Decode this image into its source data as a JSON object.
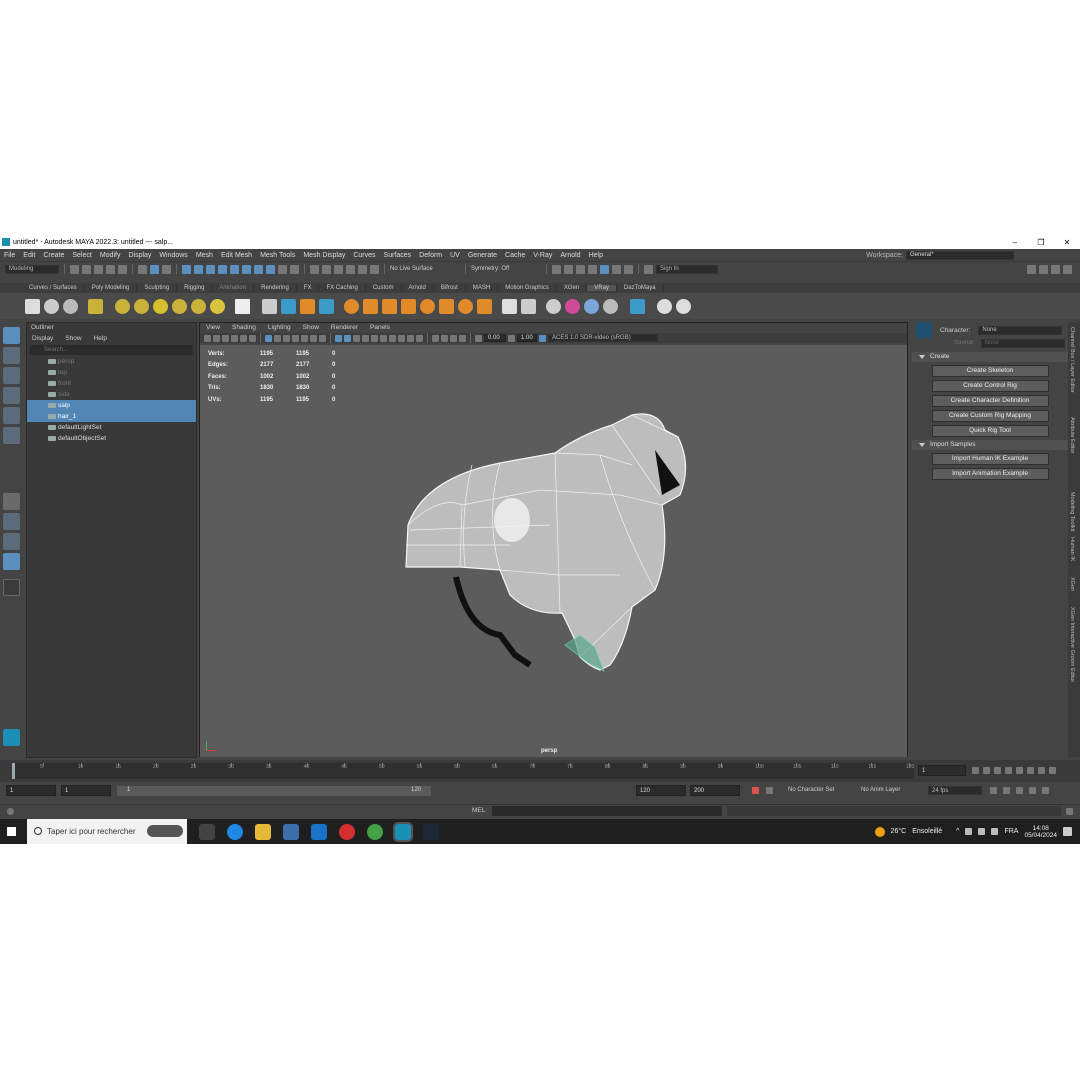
{
  "window": {
    "title": "untitled* - Autodesk MAYA 2022.3: untitled   ---   salp...",
    "controls": [
      "–",
      "❐",
      "✕"
    ]
  },
  "menubar": {
    "items": [
      "File",
      "Edit",
      "Create",
      "Select",
      "Modify",
      "Display",
      "Windows",
      "Mesh",
      "Edit Mesh",
      "Mesh Tools",
      "Mesh Display",
      "Curves",
      "Surfaces",
      "Deform",
      "UV",
      "Generate",
      "Cache",
      "V-Ray",
      "Arnold",
      "Help"
    ],
    "workspace_label": "Workspace:",
    "workspace_value": "General*"
  },
  "statusline": {
    "mode": "Modeling",
    "live_surface": "No Live Surface",
    "symmetry": "Symmetry: Off",
    "sign_in": "Sign In"
  },
  "shelf": {
    "tabs": [
      "Curves / Surfaces",
      "Poly Modeling",
      "Sculpting",
      "Rigging",
      "Animation",
      "Rendering",
      "FX",
      "FX Caching",
      "Custom",
      "Arnold",
      "Bifrost",
      "MASH",
      "Motion Graphics",
      "XGen",
      "VRay",
      "DazToMaya"
    ],
    "active_tab": "VRay"
  },
  "outliner": {
    "title": "Outliner",
    "menu": [
      "Display",
      "Show",
      "Help"
    ],
    "search_placeholder": "Search...",
    "items": [
      {
        "label": "persp",
        "state": "dim"
      },
      {
        "label": "top",
        "state": "dim"
      },
      {
        "label": "front",
        "state": "dim"
      },
      {
        "label": "side",
        "state": "dim"
      },
      {
        "label": "salp",
        "state": "selected"
      },
      {
        "label": "hair_1",
        "state": "selected"
      },
      {
        "label": "defaultLightSet",
        "state": "normal"
      },
      {
        "label": "defaultObjectSet",
        "state": "normal"
      }
    ]
  },
  "viewport": {
    "menu": [
      "View",
      "Shading",
      "Lighting",
      "Show",
      "Renderer",
      "Panels"
    ],
    "exposure": "0.00",
    "gamma": "1.00",
    "color_space": "ACES 1.0 SDR-video (sRGB)",
    "camera": "persp",
    "hud": [
      {
        "label": "Verts:",
        "a": "1195",
        "b": "1195",
        "c": "0"
      },
      {
        "label": "Edges:",
        "a": "2177",
        "b": "2177",
        "c": "0"
      },
      {
        "label": "Faces:",
        "a": "1002",
        "b": "1002",
        "c": "0"
      },
      {
        "label": "Tris:",
        "a": "1830",
        "b": "1830",
        "c": "0"
      },
      {
        "label": "UVs:",
        "a": "1195",
        "b": "1195",
        "c": "0"
      }
    ]
  },
  "humanik": {
    "character_label": "Character:",
    "character_value": "None",
    "source_label": "Source:",
    "source_value": "None",
    "create_section": "Create",
    "create_buttons": [
      "Create Skeleton",
      "Create Control Rig",
      "Create Character Definition",
      "Create Custom Rig Mapping",
      "Quick Rig Tool"
    ],
    "import_section": "Import Samples",
    "import_buttons": [
      "Import Human IK Example",
      "Import Animation Example"
    ]
  },
  "side_tabs": [
    "Channel Box / Layer Editor",
    "Attribute Editor",
    "Modeling Toolkit",
    "Human IK",
    "XGen",
    "XGen Interactive Groom Editor"
  ],
  "timeslider": {
    "ticks": [
      "5",
      "10",
      "15",
      "20",
      "25",
      "30",
      "35",
      "40",
      "45",
      "50",
      "55",
      "60",
      "65",
      "70",
      "75",
      "80",
      "85",
      "90",
      "95",
      "100",
      "105",
      "110",
      "115",
      "120"
    ],
    "current_frame": "1"
  },
  "range": {
    "start": "1",
    "playback_start": "1",
    "slider_start": "1",
    "slider_end": "120",
    "playback_end": "120",
    "end": "200",
    "character_set": "No Character Set",
    "anim_layer": "No Anim Layer",
    "fps": "24 fps"
  },
  "cmdline": {
    "lang": "MEL"
  },
  "taskbar": {
    "search_placeholder": "Taper ici pour rechercher",
    "weather_temp": "26°C",
    "weather_desc": "Ensoleillé",
    "lang": "FRA",
    "time": "14:08",
    "date": "05/04/2024"
  }
}
